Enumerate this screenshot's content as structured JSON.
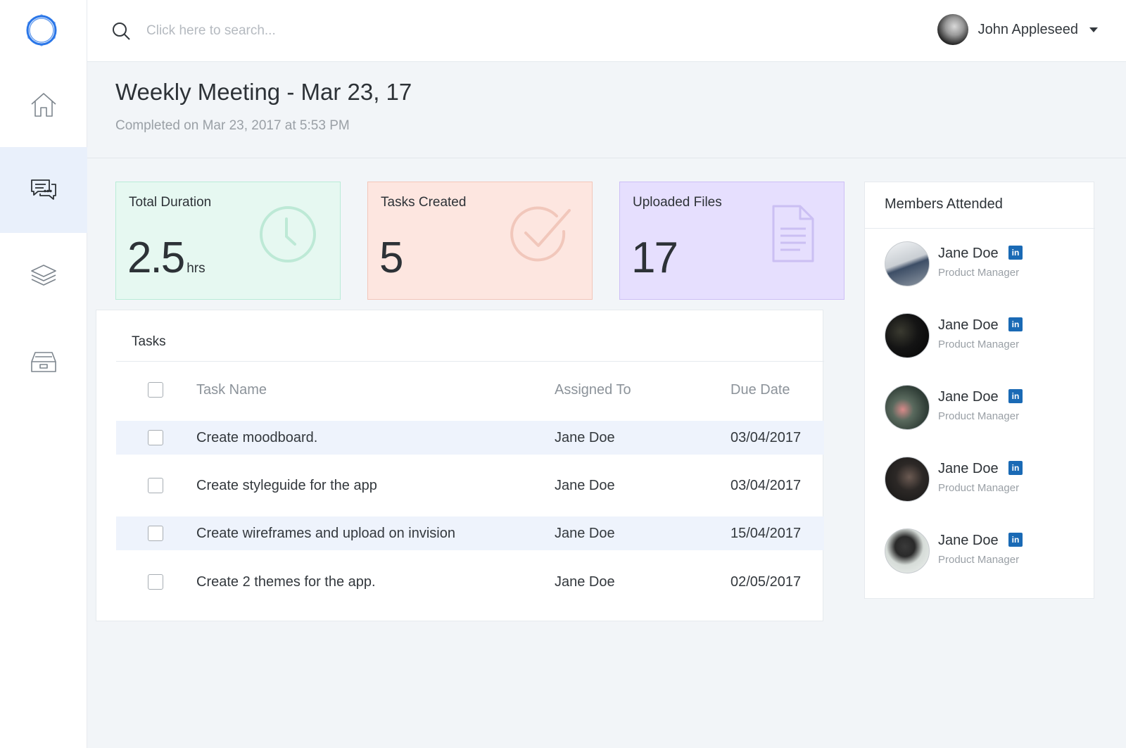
{
  "search": {
    "placeholder": "Click here to search..."
  },
  "user": {
    "name": "John Appleseed"
  },
  "header": {
    "title": "Weekly Meeting - Mar 23, 17",
    "subtitle": "Completed on Mar 23, 2017 at 5:53 PM"
  },
  "stats": [
    {
      "label": "Total Duration",
      "value": "2.5",
      "unit": "hrs",
      "icon": "clock-icon",
      "color": "#e6f8f1"
    },
    {
      "label": "Tasks Created",
      "value": "5",
      "unit": "",
      "icon": "checkmark-icon",
      "color": "#fde6e0"
    },
    {
      "label": "Uploaded Files",
      "value": "17",
      "unit": "",
      "icon": "document-icon",
      "color": "#e6dffe"
    }
  ],
  "sidebar": {
    "items": [
      {
        "icon": "home-icon"
      },
      {
        "icon": "chat-icon",
        "active": true
      },
      {
        "icon": "layers-icon"
      },
      {
        "icon": "archive-icon"
      }
    ]
  },
  "tasks": {
    "title": "Tasks",
    "columns": [
      "Task Name",
      "Assigned To",
      "Due Date"
    ],
    "rows": [
      {
        "name": "Create moodboard.",
        "assigned": "Jane Doe",
        "due": "03/04/2017"
      },
      {
        "name": "Create styleguide for the app",
        "assigned": "Jane Doe",
        "due": "03/04/2017"
      },
      {
        "name": "Create wireframes and upload on invision",
        "assigned": "Jane Doe",
        "due": "15/04/2017"
      },
      {
        "name": "Create 2 themes for the app.",
        "assigned": "Jane Doe",
        "due": "02/05/2017"
      }
    ]
  },
  "members": {
    "title": "Members Attended",
    "items": [
      {
        "name": "Jane Doe",
        "role": "Product Manager",
        "badge": "in"
      },
      {
        "name": "Jane Doe",
        "role": "Product Manager",
        "badge": "in"
      },
      {
        "name": "Jane Doe",
        "role": "Product Manager",
        "badge": "in"
      },
      {
        "name": "Jane Doe",
        "role": "Product Manager",
        "badge": "in"
      },
      {
        "name": "Jane Doe",
        "role": "Product Manager",
        "badge": "in"
      }
    ]
  },
  "colors": {
    "accent": "#2a76e8",
    "linkedin": "#1a6ab5"
  }
}
